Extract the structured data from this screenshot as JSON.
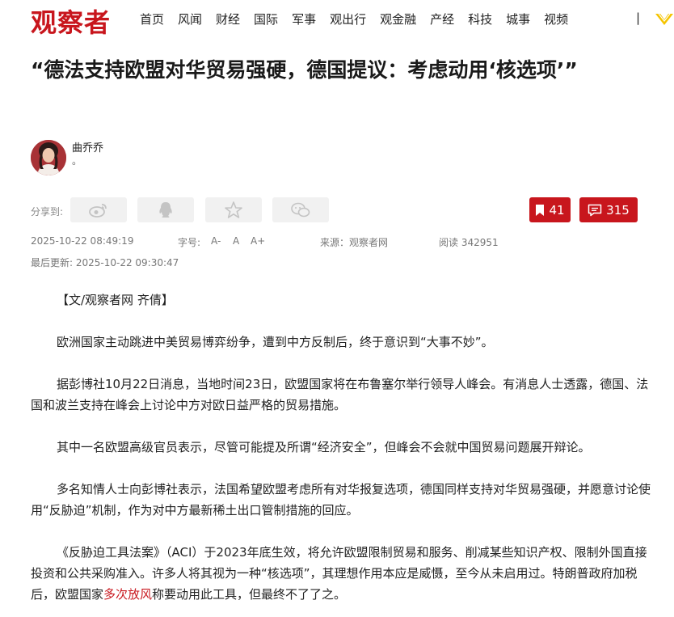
{
  "header": {
    "logo": "观察者",
    "nav": [
      "首页",
      "风闻",
      "财经",
      "国际",
      "军事",
      "观出行",
      "观金融",
      "产经",
      "科技",
      "城事",
      "视频"
    ],
    "separator": "|"
  },
  "article": {
    "title": "“德法支持欧盟对华贸易强硬，德国提议：考虑动用‘核选项’”",
    "author": {
      "name": "曲乔乔",
      "desc": "。"
    },
    "share_label": "分享到:",
    "bookmark_count": "41",
    "comment_count": "315",
    "meta": {
      "date": "2025-10-22 08:49:19",
      "font_label": "字号:",
      "font_sizes": [
        "A-",
        "A",
        "A+"
      ],
      "source": "来源：观察者网",
      "reads": "阅读 342951",
      "updated": "最后更新: 2025-10-22 09:30:47"
    },
    "paragraphs": [
      "【文/观察者网 齐倩】",
      "欧洲国家主动跳进中美贸易博弈纷争，遭到中方反制后，终于意识到“大事不妙”。",
      "据彭博社10月22日消息，当地时间23日，欧盟国家将在布鲁塞尔举行领导人峰会。有消息人士透露，德国、法国和波兰支持在峰会上讨论中方对欧日益严格的贸易措施。",
      "其中一名欧盟高级官员表示，尽管可能提及所谓“经济安全”，但峰会不会就中国贸易问题展开辩论。",
      "多名知情人士向彭博社表示，法国希望欧盟考虑所有对华报复选项，德国同样支持对华贸易强硬，并愿意讨论使用“反胁迫”机制，作为对中方最新稀土出口管制措施的回应。"
    ],
    "last_paragraph": {
      "before": "《反胁迫工具法案》（ACI）于2023年底生效，将允许欧盟限制贸易和服务、削减某些知识产权、限制外国直接投资和公共采购准入。许多人将其视为一种“核选项”，其理想作用本应是威慑，至今从未启用过。特朗普政府加税后，欧盟国家",
      "highlight": "多次放风",
      "after": "称要动用此工具，但最终不了了之。"
    }
  },
  "colors": {
    "brand": "#c8161d",
    "vip": "#f5c400"
  },
  "icons": [
    "weibo-icon",
    "qq-icon",
    "qzone-icon",
    "wechat-icon",
    "bookmark-icon",
    "comment-icon",
    "vip-icon"
  ]
}
